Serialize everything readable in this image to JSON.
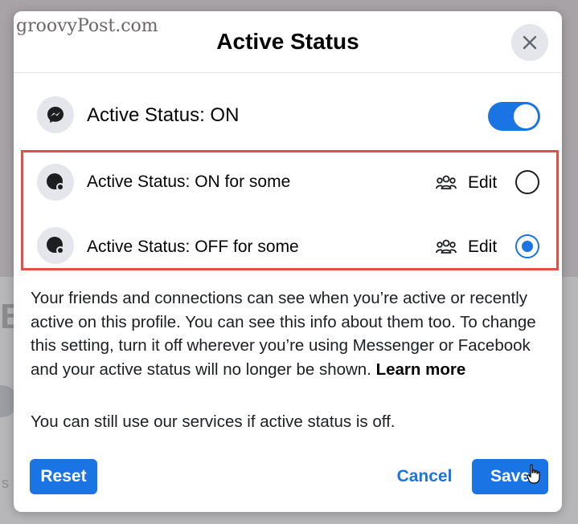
{
  "watermark": "groovyPost.com",
  "modal": {
    "title": "Active Status",
    "close_icon": "close-icon"
  },
  "master": {
    "label": "Active Status: ON",
    "icon": "messenger-icon",
    "toggle_on": true
  },
  "options": [
    {
      "label": "Active Status: ON for some",
      "edit_label": "Edit",
      "selected": false,
      "icon": "status-dot-icon"
    },
    {
      "label": "Active Status: OFF for some",
      "edit_label": "Edit",
      "selected": true,
      "icon": "status-dot-icon"
    }
  ],
  "description": {
    "text": "Your friends and connections can see when you’re active or recently active on this profile. You can see this info about them too. To change this setting, turn it off wherever you’re using Messenger or Facebook and your active status will no longer be shown.",
    "link": "Learn more",
    "note": "You can still use our services if active status is off."
  },
  "buttons": {
    "reset": "Reset",
    "cancel": "Cancel",
    "save": "Save"
  },
  "background": {
    "letter": "B",
    "fragment": "s"
  },
  "colors": {
    "accent": "#1b74e4",
    "highlight": "#e2504e"
  }
}
